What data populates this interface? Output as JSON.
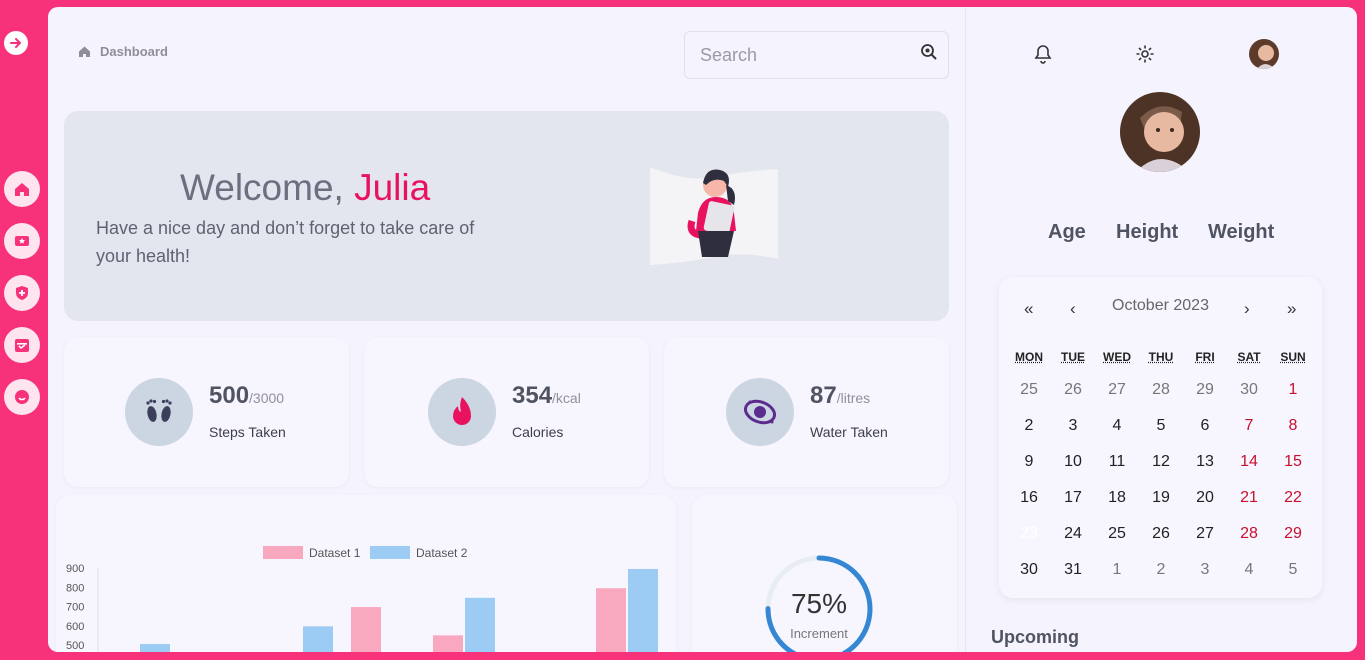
{
  "breadcrumb": {
    "label": "Dashboard"
  },
  "search": {
    "placeholder": "Search"
  },
  "hero": {
    "greeting": "Welcome, ",
    "name": "Julia",
    "subtitle": "Have a nice day and don’t forget to take care of your health!"
  },
  "stats": [
    {
      "value": "500",
      "unit": "/3000",
      "label": "Steps Taken",
      "icon": "footprints-icon"
    },
    {
      "value": "354",
      "unit": "/kcal",
      "label": "Calories",
      "icon": "flame-icon"
    },
    {
      "value": "87",
      "unit": "/litres",
      "label": "Water Taken",
      "icon": "galaxy-icon"
    }
  ],
  "profile": {
    "metrics": [
      "Age",
      "Height",
      "Weight"
    ]
  },
  "calendar": {
    "month_label": "October 2023",
    "nav": {
      "prev_year": "«",
      "prev_month": "‹",
      "next_month": "›",
      "next_year": "»"
    },
    "weekdays": [
      "MON",
      "TUE",
      "WED",
      "THU",
      "FRI",
      "SAT",
      "SUN"
    ],
    "weeks": [
      [
        "25",
        "26",
        "27",
        "28",
        "29",
        "30",
        "1"
      ],
      [
        "2",
        "3",
        "4",
        "5",
        "6",
        "7",
        "8"
      ],
      [
        "9",
        "10",
        "11",
        "12",
        "13",
        "14",
        "15"
      ],
      [
        "16",
        "17",
        "18",
        "19",
        "20",
        "21",
        "22"
      ],
      [
        "23",
        "24",
        "25",
        "26",
        "27",
        "28",
        "29"
      ],
      [
        "30",
        "31",
        "1",
        "2",
        "3",
        "4",
        "5"
      ]
    ],
    "today": "23"
  },
  "upcoming": {
    "title": "Upcoming"
  },
  "progress": {
    "value": "75%",
    "label": "Increment",
    "fraction": 0.75
  },
  "chart_data": {
    "type": "bar",
    "series": [
      {
        "name": "Dataset 1",
        "color": "#f8a9bf"
      },
      {
        "name": "Dataset 2",
        "color": "#9ccbf3"
      }
    ],
    "y_ticks": [
      "900",
      "800",
      "700",
      "600",
      "500"
    ],
    "ylim": [
      500,
      900
    ],
    "groups": [
      {
        "values": [
          null,
          505
        ]
      },
      {
        "values": [
          null,
          597
        ]
      },
      {
        "values": [
          697,
          null
        ]
      },
      {
        "values": [
          550,
          745
        ]
      },
      {
        "values": [
          795,
          895
        ]
      }
    ]
  }
}
